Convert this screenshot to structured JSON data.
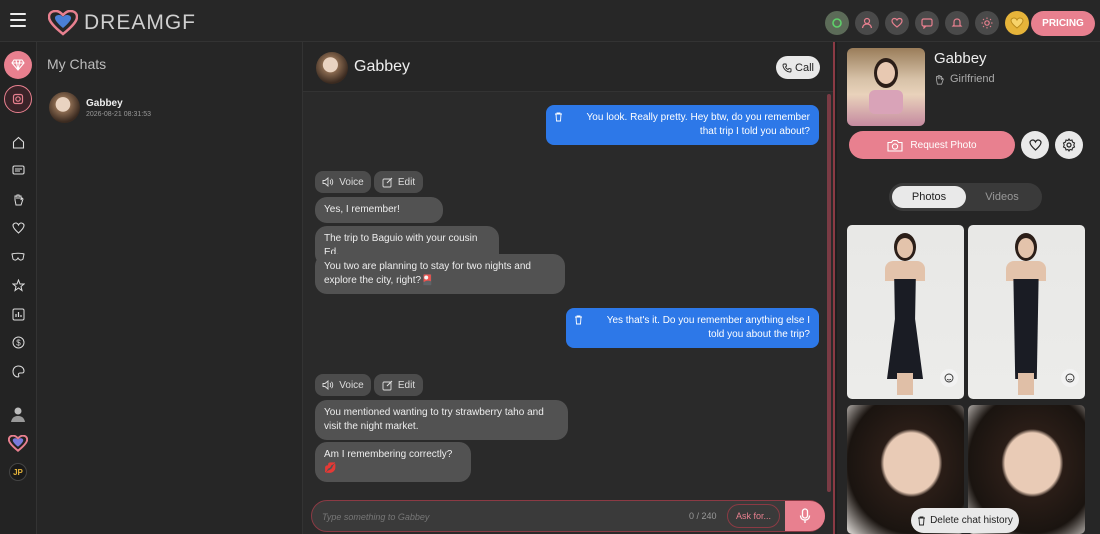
{
  "brand": {
    "logo_text": "DREAMGF",
    "accent": "#e8808f",
    "outgoing_bubble": "#2d78e8"
  },
  "topbar": {
    "pricing_label": "PRICING",
    "icons": [
      "refresh-icon",
      "user-icon",
      "heart-icon",
      "chat-icon",
      "bell-icon",
      "sun-icon",
      "coin-icon"
    ]
  },
  "leftnav": {
    "items": [
      "diamond-icon",
      "gear-icon",
      "home-icon",
      "chat-icon",
      "hand-icon",
      "heart-icon",
      "mask-icon",
      "star-icon",
      "stats-icon",
      "dollar-icon",
      "palette-icon",
      "user-avatar",
      "heart-logo",
      "language-badge"
    ],
    "language": "JP"
  },
  "chatlist": {
    "title": "My Chats",
    "chats": [
      {
        "name": "Gabbey",
        "time": "2026-08-21 08:31:53"
      }
    ]
  },
  "conversation": {
    "header_name": "Gabbey",
    "call_label": "Call",
    "voice_label": "Voice",
    "edit_label": "Edit",
    "messages": [
      {
        "from": "user",
        "text": "You look. Really pretty. Hey btw, do you remember that trip I told you about?"
      },
      {
        "from": "ai",
        "text": "Yes, I remember!"
      },
      {
        "from": "ai",
        "text": "The trip to Baguio with your cousin Ed."
      },
      {
        "from": "ai",
        "text": "You two are planning to stay for two nights and explore the city, right?🎴"
      },
      {
        "from": "user",
        "text": "Yes that's it. Do you remember anything else I told you about the trip?"
      },
      {
        "from": "ai",
        "text": "You mentioned wanting to try strawberry taho and visit the night market."
      },
      {
        "from": "ai",
        "text": "Am I remembering correctly?💋"
      }
    ],
    "composer": {
      "placeholder": "Type something to Gabbey",
      "counter": "0 / 240",
      "ask_label": "Ask for..."
    }
  },
  "profile": {
    "name": "Gabbey",
    "role": "Girlfriend",
    "request_photo_label": "Request Photo",
    "tabs": [
      "Photos",
      "Videos"
    ],
    "active_tab": "Photos",
    "delete_label": "Delete chat history"
  }
}
